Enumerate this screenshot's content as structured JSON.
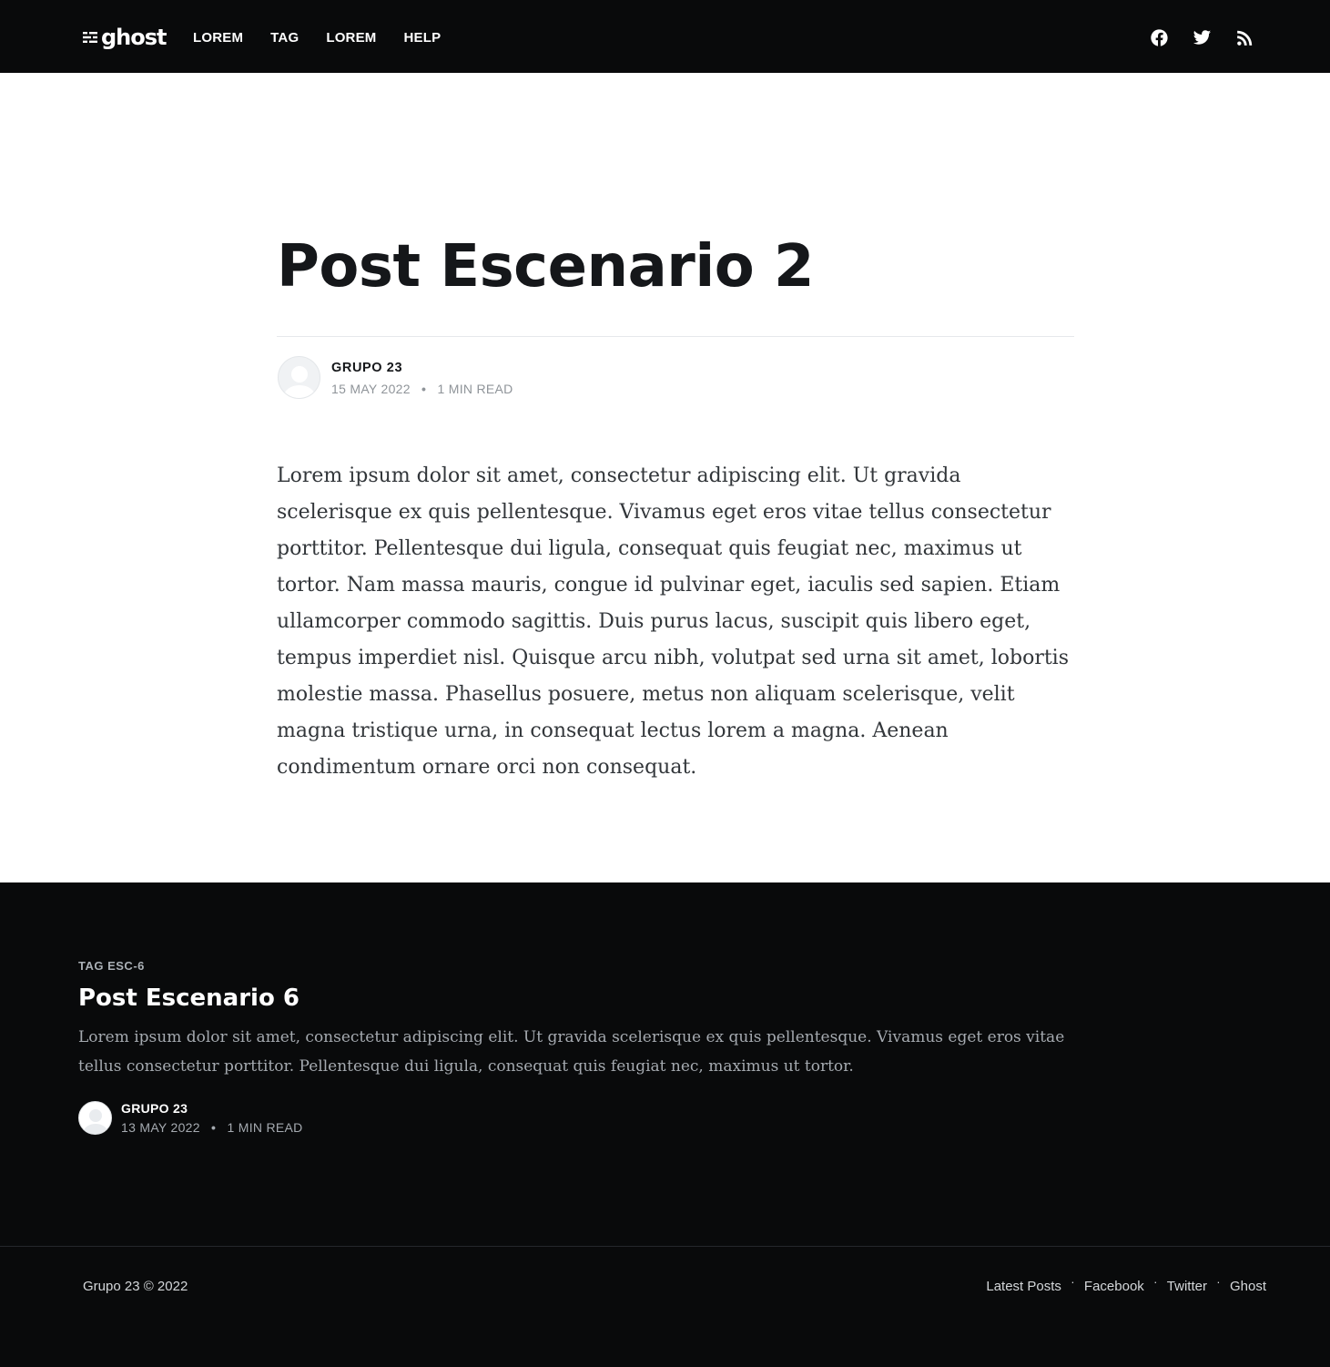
{
  "header": {
    "logo_text": "ghost",
    "nav": [
      "LOREM",
      "TAG",
      "LOREM",
      "HELP"
    ],
    "social_icons": [
      "facebook-icon",
      "twitter-icon",
      "rss-icon"
    ]
  },
  "post": {
    "title": "Post Escenario 2",
    "author": "GRUPO 23",
    "date": "15 MAY 2022",
    "separator": "•",
    "read_time": "1 MIN READ",
    "body": "Lorem ipsum dolor sit amet, consectetur adipiscing elit. Ut gravida scelerisque ex quis pellentesque. Vivamus eget eros vitae tellus consectetur porttitor. Pellentesque dui ligula, consequat quis feugiat nec, maximus ut tortor. Nam massa mauris, congue id pulvinar eget, iaculis sed sapien. Etiam ullamcorper commodo sagittis. Duis purus lacus, suscipit quis libero eget, tempus imperdiet nisl. Quisque arcu nibh, volutpat sed urna sit amet, lobortis molestie massa. Phasellus posuere, metus non aliquam scelerisque, velit magna tristique urna, in consequat lectus lorem a magna. Aenean condimentum ornare orci non consequat."
  },
  "related": {
    "tag": "TAG ESC-6",
    "title": "Post Escenario 6",
    "excerpt": "Lorem ipsum dolor sit amet, consectetur adipiscing elit. Ut gravida scelerisque ex quis pellentesque. Vivamus eget eros vitae tellus consectetur porttitor. Pellentesque dui ligula, consequat quis feugiat nec, maximus ut tortor.",
    "author": "GRUPO 23",
    "date": "13 MAY 2022",
    "separator": "•",
    "read_time": "1 MIN READ"
  },
  "footer": {
    "copyright": "Grupo 23 © 2022",
    "links": [
      "Latest Posts",
      "Facebook",
      "Twitter",
      "Ghost"
    ],
    "separator": "·"
  },
  "colors": {
    "header_bg": "#090a0b",
    "title": "#15171a",
    "meta": "#8f9499",
    "body_text": "#32363a"
  }
}
